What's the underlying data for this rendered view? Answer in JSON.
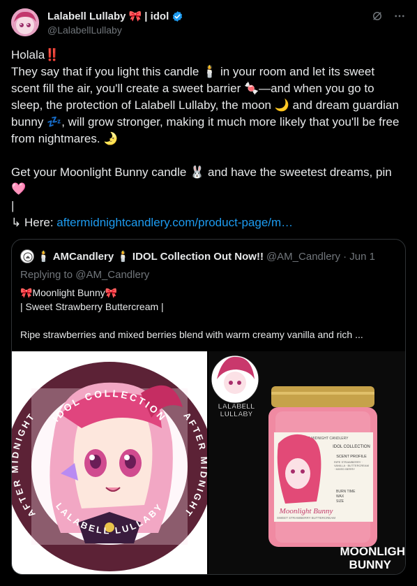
{
  "author": {
    "name": "Lalabell Lullaby",
    "name_suffix": "| idol",
    "handle": "@LalabellLullaby",
    "verified": true
  },
  "icons": {
    "ribbon": "ribbon-emoji",
    "verified": "verified-badge-icon",
    "grok": "grok-icon",
    "more": "more-icon"
  },
  "tweet": {
    "line1": "Holala",
    "line1_emoji": "‼️",
    "para1_a": "They say that if you light this candle",
    "para1_b": "in your room and let its sweet scent fill the air, you'll create a sweet barrier",
    "para1_c": "—and when you go to sleep, the protection of Lalabell Lullaby, the moon",
    "para1_d": "and dream guardian bunny",
    "para1_e": ", will grow stronger, making it much more likely that you'll be free from nightmares.",
    "para2_a": "Get your Moonlight Bunny candle",
    "para2_b": "and have the sweetest dreams, pin",
    "bar": "|",
    "here_label": "↳ Here:",
    "link": "aftermidnightcandlery.com/product-page/m…",
    "emoji_candle": "🕯️",
    "emoji_candy": "🍬",
    "emoji_moon": "🌙",
    "emoji_zzz": "💤",
    "emoji_moon2": "🌛",
    "emoji_bunny": "🐰",
    "emoji_heart": "🩷"
  },
  "quote": {
    "candle_emoji": "🕯️",
    "name_a": "AMCandlery",
    "name_b": "IDOL Collection Out Now!!",
    "handle": "@AM_Candlery",
    "date": "· Jun 1",
    "replying": "Replying to @AM_Candlery",
    "title_emoji": "🎀",
    "title": "Moonlight Bunny",
    "subtitle": "| Sweet Strawberry Buttercream |",
    "desc": "Ripe strawberries and mixed berries blend with warm creamy vanilla and rich ..."
  },
  "images": {
    "left": {
      "top_arc": "IDOL COLLECTION",
      "left_arc": "AFTER MIDNIGHT",
      "right_arc": "AFTER MIDNIGHT",
      "bottom_arc": "LALABELL LULLABY"
    },
    "right": {
      "badge_line1": "LALABELL",
      "badge_line2": "LULLABY",
      "label_header": "AFTER MIDNIGHT CANDLERY",
      "label_collection": "IDOL COLLECTION",
      "label_profile": "SCENT PROFILE",
      "label_notes": "RIPE STRAWBERRY · VANILLA · BUTTERCREAM · MIXED BERRY",
      "label_burn": "BURN TIME",
      "label_wax": "WAX",
      "label_size": "SIZE",
      "label_title": "Moonlight Bunny",
      "label_sub": "SWEET STRAWBERRY BUTTERCREAM",
      "corner_line1": "MOONLIGH",
      "corner_line2": "BUNNY"
    }
  },
  "colors": {
    "background": "#000000",
    "text": "#e7e9ea",
    "muted": "#71767b",
    "link": "#1d9bf0",
    "border": "#2f3336",
    "verified": "#1d9bf0",
    "plum": "#5c2236"
  }
}
